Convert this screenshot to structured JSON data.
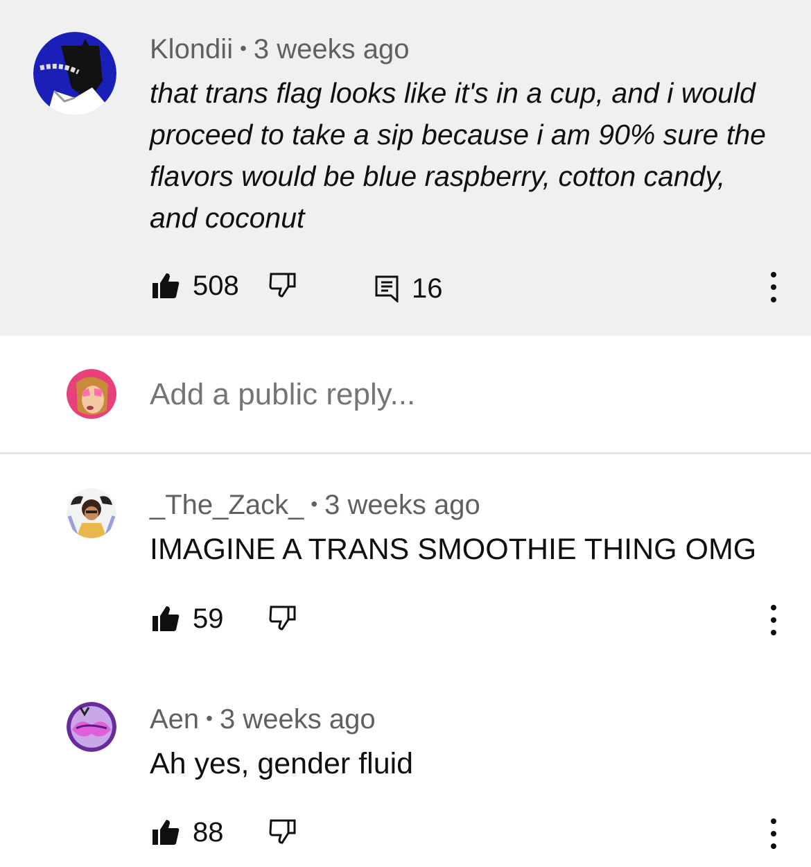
{
  "comments": [
    {
      "author": "Klondii",
      "time": "3 weeks ago",
      "text": "that trans flag looks like it's in a cup, and i would proceed to take a sip because i am 90% sure the flavors would be blue raspberry, cotton candy, and coconut",
      "likes": "508",
      "replies": "16"
    },
    {
      "author": "_The_Zack_",
      "time": "3 weeks ago",
      "text": "IMAGINE A TRANS SMOOTHIE THING OMG",
      "likes": "59"
    },
    {
      "author": "Aen",
      "time": "3 weeks ago",
      "text": "Ah yes, gender fluid",
      "likes": "88"
    }
  ],
  "reply_box": {
    "placeholder": "Add a public reply..."
  },
  "icons": {
    "like": "thumbs-up-icon",
    "dislike": "thumbs-down-icon",
    "replies": "reply-comment-icon",
    "more": "more-vert-icon"
  },
  "colors": {
    "highlight_bg": "#f0f0f0",
    "meta_text": "#606060",
    "body_text": "#0f0f0f"
  }
}
